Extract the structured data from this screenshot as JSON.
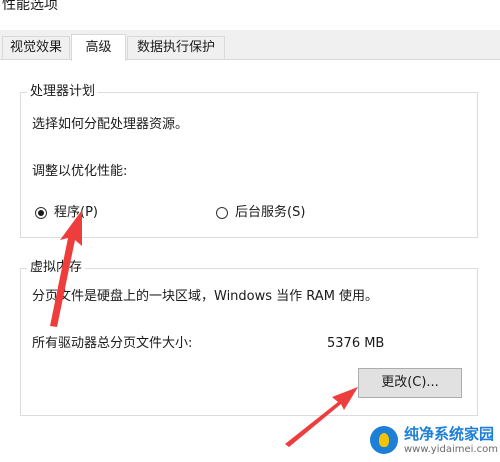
{
  "window": {
    "title": "性能选项"
  },
  "tabs": [
    {
      "label": "视觉效果"
    },
    {
      "label": "高级"
    },
    {
      "label": "数据执行保护"
    }
  ],
  "processor_group": {
    "legend": "处理器计划",
    "description": "选择如何分配处理器资源。",
    "adjust_label": "调整以优化性能:",
    "options": [
      {
        "label": "程序(P)",
        "selected": true
      },
      {
        "label": "后台服务(S)",
        "selected": false
      }
    ]
  },
  "vm_group": {
    "legend": "虚拟内存",
    "description": "分页文件是硬盘上的一块区域，Windows 当作 RAM 使用。",
    "total_label": "所有驱动器总分页文件大小:",
    "total_value": "5376 MB",
    "change_button": "更改(C)..."
  },
  "watermark": {
    "title": "纯净系统家园",
    "url": "www.yidaimei.com"
  },
  "colors": {
    "arrow": "#ee3d3d",
    "watermark_blue": "#1e7fd8"
  }
}
